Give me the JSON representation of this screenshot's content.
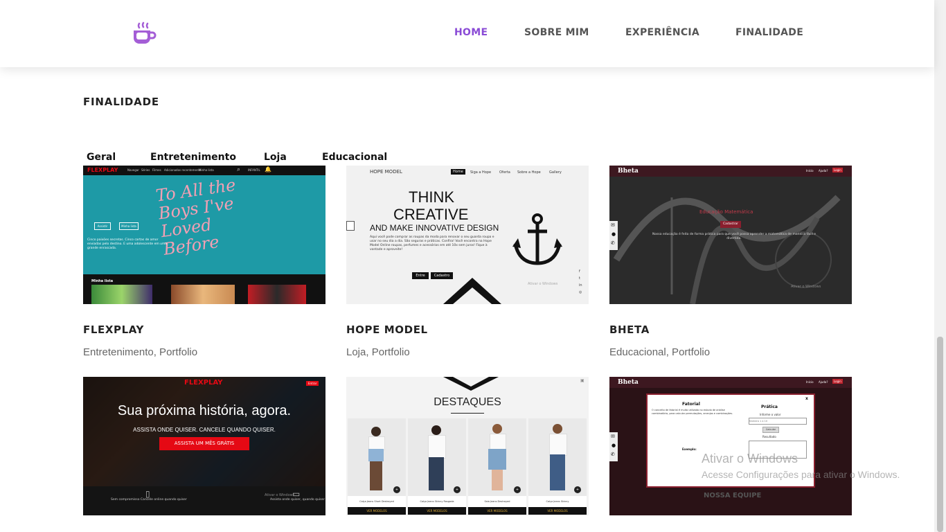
{
  "nav": {
    "links": [
      {
        "label": "HOME"
      },
      {
        "label": "SOBRE MIM"
      },
      {
        "label": "EXPERIÊNCIA"
      },
      {
        "label": "FINALIDADE"
      }
    ],
    "accent_color": "#8a4bd6"
  },
  "section": {
    "title": "FINALIDADE"
  },
  "filters": [
    "Geral",
    "Entretenimento",
    "Loja",
    "Educacional"
  ],
  "projects": [
    {
      "title": "FLEXPLAY",
      "tags": "Entretenimento, Portfolio",
      "preview": {
        "brand": "FLEXPLAY",
        "menu": [
          "Navegar",
          "Séries",
          "Filmes",
          "Adicionados recentemente",
          "Minha lista"
        ],
        "user": "INFANTIL",
        "hero_script": "To All the Boys I've Loved Before",
        "btn_watch": "Assistir",
        "btn_list": "Minha lista",
        "desc": "Cinco paixões secretas. Cinco cartas de amor enviadas pelo destino. E uma adolescente em uma grande enrascada.",
        "row_label": "Minha lista"
      }
    },
    {
      "title": "HOPE MODEL",
      "tags": "Loja, Portfolio",
      "preview": {
        "brand": "HOPE MODEL",
        "menu": [
          "Home",
          "Siga a Hope",
          "Oferta",
          "Sobre a Hope",
          "Gallery"
        ],
        "h1": "THINK",
        "h2": "CREATIVE",
        "h3": "AND MAKE INNOVATIVE DESIGN",
        "desc": "Aqui você pode comprar as roupas da moda para renovar o seu guarda roupa e usar no seu dia a dia. São seguras e práticas. Confira! Você encontra na Hope Model Online roupas, perfumes e acessórios em até 10x sem juros! Fique à vontade e aproveite!",
        "btn_enter": "Entre",
        "btn_signup": "Cadastro",
        "watermark": "Ativar o Windows"
      }
    },
    {
      "title": "BHETA",
      "tags": "Educacional, Portfolio",
      "preview": {
        "brand": "Bheta",
        "menu": [
          "Início",
          "Ajuda?",
          "Login"
        ],
        "heading": "Educação Matemática",
        "btn": "Cadastrar",
        "desc": "Nossa educação é feita de forma prática para que você possa aprender a matemática de maneira fácil e divertida.",
        "watermark": "Ativar o Windows"
      }
    },
    {
      "preview": {
        "brand": "FLEXPLAY",
        "login": "Entrar",
        "headline": "Sua próxima história, agora.",
        "sub": "ASSISTA ONDE QUISER. CANCELE QUANDO QUISER.",
        "cta": "ASSISTA UM MÊS GRÁTIS",
        "feature1": "Sem compromisso Cancele online quando quiser",
        "feature2": "Assista onde quiser, quando quiser",
        "watermark": "Ativar o Windows"
      }
    },
    {
      "preview": {
        "heading": "DESTAQUES",
        "products": [
          {
            "name": "Calça Jeans Short Destroyed",
            "btn": "VER MODELOS"
          },
          {
            "name": "Calça Jeans Skinny Rasgada",
            "btn": "VER MODELOS"
          },
          {
            "name": "Saia Jeans Destroyed",
            "btn": "VER MODELOS"
          },
          {
            "name": "Calça Jeans Skinny",
            "btn": "VER MODELOS"
          }
        ]
      }
    },
    {
      "preview": {
        "brand": "Bheta",
        "menu": [
          "Início",
          "Ajuda?",
          "Login"
        ],
        "modal_title": "Fatorial",
        "modal_text": "O conceito de fatorial é muito utilizado no estudo de análise combinatória, para calcular permutações, arranjos e combinações.",
        "modal_example": "Exemplo:",
        "practice_title": "Prática",
        "practice_label": "Informe o valor",
        "practice_placeholder": "Número 1 a 10",
        "practice_btn": "Calcular",
        "result_label": "Resultado",
        "team": "NOSSA EQUIPE",
        "close": "x"
      }
    }
  ],
  "watermark": {
    "title": "Ativar o Windows",
    "subtitle": "Acesse Configurações para ativar o Windows."
  }
}
